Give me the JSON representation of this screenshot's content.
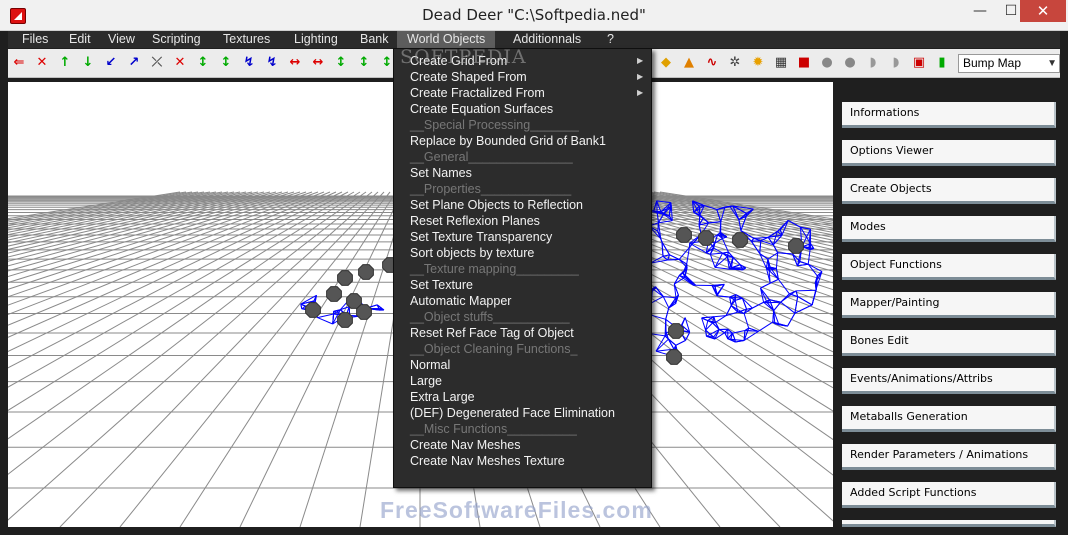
{
  "window": {
    "title": "Dead Deer \"C:\\Softpedia.ned\"",
    "minimize": "—",
    "maximize": "☐",
    "close": "✕"
  },
  "menubar": {
    "items": [
      "Files",
      "Edit",
      "View",
      "Scripting",
      "Textures",
      "Lighting",
      "Bank",
      "World Objects",
      "Additionnals",
      "?"
    ]
  },
  "toolbar": {
    "bump_map": "Bump Map"
  },
  "world_objects_menu": {
    "items": [
      {
        "label": "Create Grid From",
        "submenu": true
      },
      {
        "label": "Create Shaped From",
        "submenu": true
      },
      {
        "label": "Create Fractalized From",
        "submenu": true
      },
      {
        "label": "Create Equation Surfaces"
      },
      {
        "label": "__Special Processing_______",
        "separator": true
      },
      {
        "label": "Replace by Bounded Grid of Bank1"
      },
      {
        "label": "__General_______________",
        "separator": true
      },
      {
        "label": "Set Names"
      },
      {
        "label": "__Properties_____________",
        "separator": true
      },
      {
        "label": "Set Plane Objects to Reflection"
      },
      {
        "label": "Reset Reflexion Planes"
      },
      {
        "label": "Set Texture Transparency"
      },
      {
        "label": "Sort objects by texture"
      },
      {
        "label": "__Texture mapping_________",
        "separator": true
      },
      {
        "label": "Set Texture"
      },
      {
        "label": "Automatic Mapper"
      },
      {
        "label": "__Object stuffs___________",
        "separator": true
      },
      {
        "label": "Reset Ref Face Tag of Object"
      },
      {
        "label": "__Object Cleaning Functions_",
        "separator": true
      },
      {
        "label": "Normal"
      },
      {
        "label": "Large"
      },
      {
        "label": "Extra Large"
      },
      {
        "label": "(DEF) Degenerated Face Elimination"
      },
      {
        "label": "__Misc Functions__________",
        "separator": true
      },
      {
        "label": "Create Nav Meshes"
      },
      {
        "label": "Create Nav Meshes Texture"
      }
    ]
  },
  "right_panel": {
    "buttons": [
      "Informations",
      "Options Viewer",
      "Create Objects",
      "Modes",
      "Object Functions",
      "Mapper/Painting",
      "Bones Edit",
      "Events/Animations/Attribs",
      "Metaballs Generation",
      "Render Parameters / Animations",
      "Added Script Functions"
    ]
  },
  "watermarks": {
    "top": "SOFTPEDIA",
    "bottom": "FreeSoftwareFiles.com"
  },
  "colors": {
    "menubar": "#2b2b2b",
    "menu_highlight": "#5d5d5d",
    "dropdown_bg": "#2c2c2c",
    "mesh": "#0000ff",
    "close_button": "#c7463d"
  }
}
